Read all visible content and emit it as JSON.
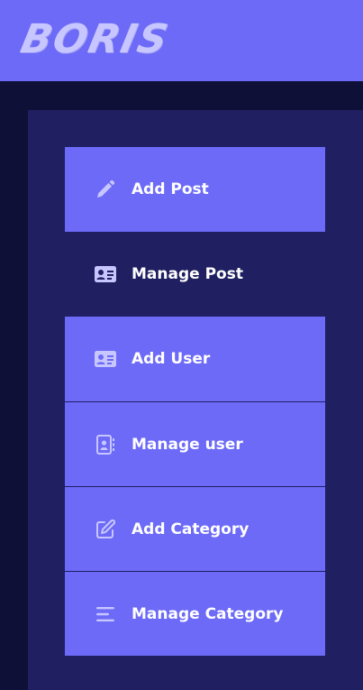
{
  "header": {
    "logo_text": "BORIS"
  },
  "sidebar": {
    "items": [
      {
        "label": "Add Post",
        "icon": "pencil-icon",
        "active": true
      },
      {
        "label": "Manage Post",
        "icon": "id-card-icon",
        "active": false
      },
      {
        "label": "Add User",
        "icon": "id-card-icon",
        "active": true
      },
      {
        "label": "Manage user",
        "icon": "address-book-icon",
        "active": true
      },
      {
        "label": "Add Category",
        "icon": "edit-square-icon",
        "active": true
      },
      {
        "label": "Manage Category",
        "icon": "menu-lines-icon",
        "active": true
      }
    ]
  },
  "colors": {
    "topbar": "#6c6af7",
    "page_background": "#0e1038",
    "panel": "#1f1f61",
    "menu_item": "#6c6af7",
    "icon": "#c8c6ff",
    "text": "#ffffff"
  }
}
